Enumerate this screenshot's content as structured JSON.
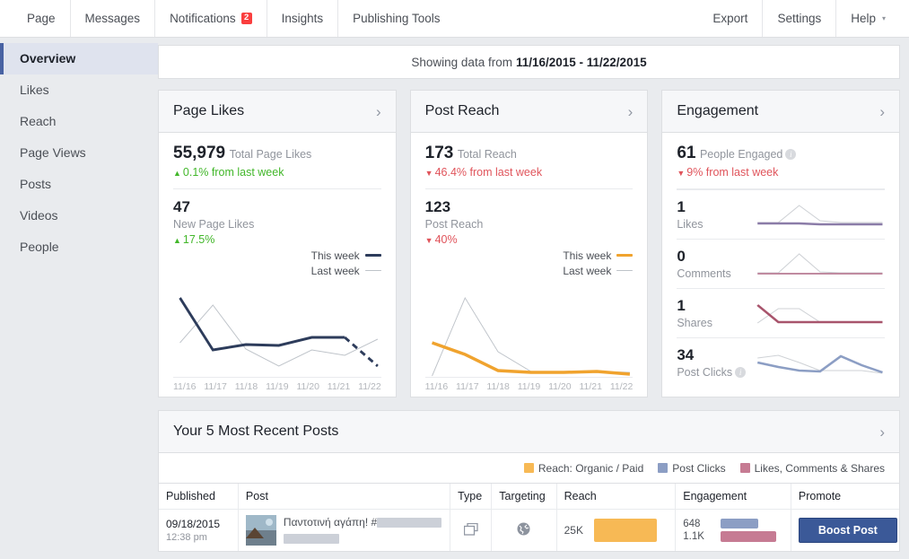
{
  "topnav": {
    "left_items": [
      {
        "label": "Page",
        "name": "nav-page"
      },
      {
        "label": "Messages",
        "name": "nav-messages"
      },
      {
        "label": "Notifications",
        "name": "nav-notifications",
        "badge": "2"
      },
      {
        "label": "Insights",
        "name": "nav-insights"
      },
      {
        "label": "Publishing Tools",
        "name": "nav-publishing-tools"
      }
    ],
    "right_items": [
      {
        "label": "Export",
        "name": "nav-export"
      },
      {
        "label": "Settings",
        "name": "nav-settings"
      },
      {
        "label": "Help",
        "name": "nav-help",
        "caret": "▾"
      }
    ]
  },
  "sidebar": {
    "items": [
      {
        "label": "Overview",
        "active": true
      },
      {
        "label": "Likes",
        "active": false
      },
      {
        "label": "Reach",
        "active": false
      },
      {
        "label": "Page Views",
        "active": false
      },
      {
        "label": "Posts",
        "active": false
      },
      {
        "label": "Videos",
        "active": false
      },
      {
        "label": "People",
        "active": false
      }
    ]
  },
  "daterange": {
    "prefix": "Showing data from",
    "range": "11/16/2015 - 11/22/2015"
  },
  "cards": {
    "page_likes": {
      "title": "Page Likes",
      "total_value": "55,979",
      "total_label": "Total Page Likes",
      "total_change": "0.1% from last week",
      "total_change_dir": "up",
      "sub_value": "47",
      "sub_label": "New Page Likes",
      "sub_change": "17.5%",
      "sub_change_dir": "up"
    },
    "post_reach": {
      "title": "Post Reach",
      "total_value": "173",
      "total_label": "Total Reach",
      "total_change": "46.4% from last week",
      "total_change_dir": "down",
      "sub_value": "123",
      "sub_label": "Post Reach",
      "sub_change": "40%",
      "sub_change_dir": "down"
    },
    "engagement": {
      "title": "Engagement",
      "total_value": "61",
      "total_label": "People Engaged",
      "total_change": "9% from last week",
      "total_change_dir": "down",
      "rows": [
        {
          "value": "1",
          "label": "Likes",
          "info": false,
          "color": "#8b7ca8"
        },
        {
          "value": "0",
          "label": "Comments",
          "info": false,
          "color": "#c08ba0"
        },
        {
          "value": "1",
          "label": "Shares",
          "info": false,
          "color": "#a8546c"
        },
        {
          "value": "34",
          "label": "Post Clicks",
          "info": true,
          "color": "#8c9ec4"
        }
      ]
    }
  },
  "chart_legend": {
    "this_week": "This week",
    "last_week": "Last week"
  },
  "chart_data": [
    {
      "type": "line",
      "title": "Page Likes",
      "x": [
        "11/16",
        "11/17",
        "11/18",
        "11/19",
        "11/20",
        "11/21",
        "11/22"
      ],
      "series": [
        {
          "name": "This week",
          "color": "#2d3c5b",
          "values": [
            88,
            30,
            36,
            35,
            44,
            44,
            12
          ]
        },
        {
          "name": "Last week",
          "color": "#bec3c9",
          "values": [
            38,
            80,
            31,
            12,
            30,
            24,
            44
          ]
        }
      ],
      "xlabel": "",
      "ylabel": "",
      "ylim": [
        0,
        100
      ],
      "grid": false,
      "legend": "top-right"
    },
    {
      "type": "line",
      "title": "Post Reach",
      "x": [
        "11/16",
        "11/17",
        "11/18",
        "11/19",
        "11/20",
        "11/21",
        "11/22"
      ],
      "series": [
        {
          "name": "This week",
          "color": "#f0a32e",
          "values": [
            38,
            25,
            7,
            5,
            5,
            6,
            3
          ]
        },
        {
          "name": "Last week",
          "color": "#bec3c9",
          "values": [
            0,
            88,
            17,
            4,
            4,
            4,
            4
          ]
        }
      ],
      "xlabel": "",
      "ylabel": "",
      "ylim": [
        0,
        100
      ],
      "grid": false,
      "legend": "top-right"
    },
    {
      "type": "line",
      "title": "Likes sparkline",
      "series": [
        {
          "name": "This week",
          "color": "#8b7ca8",
          "values": [
            8,
            8,
            8,
            7,
            7,
            7,
            7
          ]
        },
        {
          "name": "Last week",
          "color": "#cfd2d6",
          "values": [
            8,
            30,
            10,
            7,
            7,
            7,
            7
          ]
        }
      ]
    },
    {
      "type": "line",
      "title": "Comments sparkline",
      "series": [
        {
          "name": "This week",
          "color": "#c08ba0",
          "values": [
            6,
            6,
            6,
            6,
            6,
            6,
            6
          ]
        },
        {
          "name": "Last week",
          "color": "#cfd2d6",
          "values": [
            6,
            30,
            8,
            6,
            6,
            6,
            6
          ]
        }
      ]
    },
    {
      "type": "line",
      "title": "Shares sparkline",
      "series": [
        {
          "name": "This week",
          "color": "#a8546c",
          "values": [
            30,
            6,
            6,
            6,
            6,
            6,
            6
          ]
        },
        {
          "name": "Last week",
          "color": "#cfd2d6",
          "values": [
            6,
            22,
            22,
            6,
            6,
            6,
            6
          ]
        }
      ]
    },
    {
      "type": "line",
      "title": "Post Clicks sparkline",
      "series": [
        {
          "name": "This week",
          "color": "#8c9ec4",
          "values": [
            22,
            16,
            11,
            10,
            26,
            16,
            9
          ]
        },
        {
          "name": "Last week",
          "color": "#cfd2d6",
          "values": [
            26,
            29,
            20,
            9,
            9,
            9,
            7
          ]
        }
      ]
    }
  ],
  "posts_section": {
    "title": "Your 5 Most Recent Posts",
    "legend": [
      {
        "label": "Reach: Organic / Paid",
        "color": "#f7b955"
      },
      {
        "label": "Post Clicks",
        "color": "#8c9ec4"
      },
      {
        "label": "Likes, Comments & Shares",
        "color": "#c67b93"
      }
    ],
    "columns": [
      "Published",
      "Post",
      "Type",
      "Targeting",
      "Reach",
      "Engagement",
      "Promote"
    ],
    "rows": [
      {
        "date": "09/18/2015",
        "time": "12:38 pm",
        "post_text": "Παντοτινή αγάπη! #",
        "type_icon": "photo-icon",
        "targeting_icon": "globe-icon",
        "reach_value": "25K",
        "engagement_clicks": "648",
        "engagement_reactions": "1.1K",
        "promote_label": "Boost Post"
      }
    ]
  },
  "colors": {
    "facebook_blue": "#3b5998",
    "accent_orange": "#f0a32e",
    "navy_line": "#2d3c5b",
    "up_green": "#42b72a",
    "down_red": "#e0545b",
    "badge_red": "#fa3e3e"
  }
}
